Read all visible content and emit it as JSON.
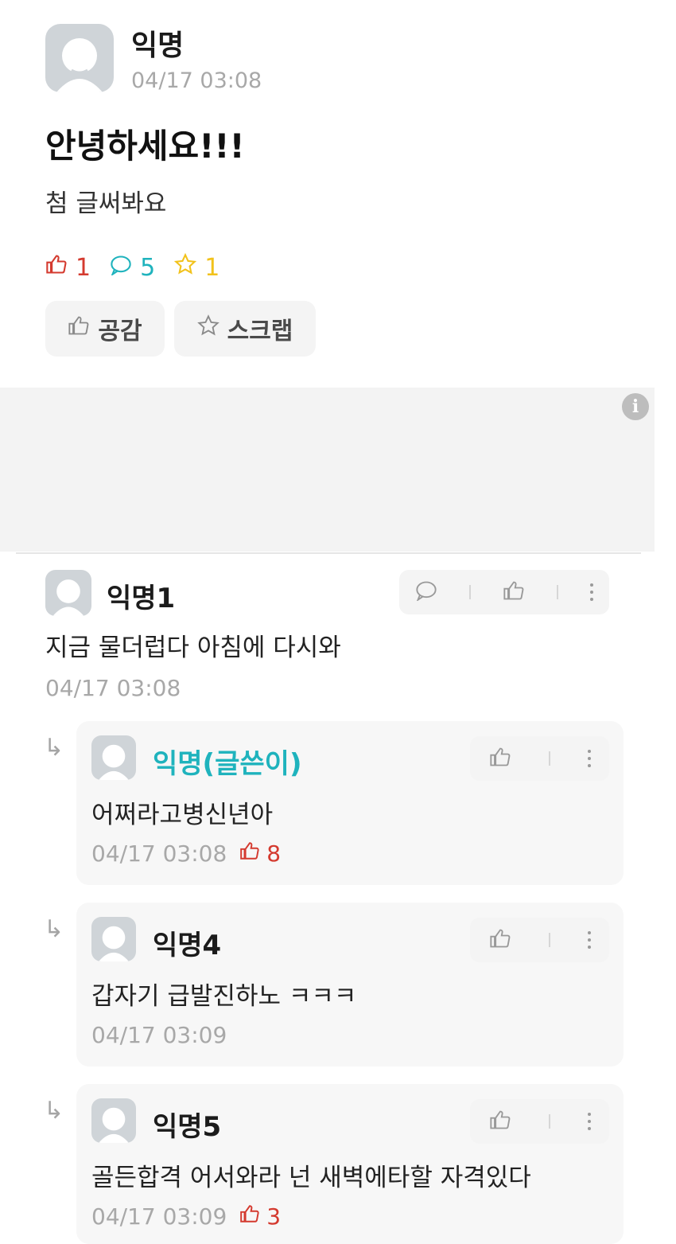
{
  "post": {
    "author": "익명",
    "time": "04/17 03:08",
    "title": "안녕하세요!!!",
    "body": "첨 글써봐요",
    "stats": {
      "likes": "1",
      "comments": "5",
      "scraps": "1"
    },
    "buttons": {
      "like": "공감",
      "scrap": "스크랩"
    }
  },
  "comments": [
    {
      "author": "익명1",
      "text": "지금 물더럽다 아침에 다시와",
      "time": "04/17 03:08"
    }
  ],
  "replies": [
    {
      "author": "익명(글쓴이)",
      "text": "어쩌라고병신년아",
      "time": "04/17 03:08",
      "likes": "8"
    },
    {
      "author": "익명4",
      "text": "갑자기 급발진하노 ㅋㅋㅋ",
      "time": "04/17 03:09"
    },
    {
      "author": "익명5",
      "text": "골든합격 어서와라 넌 새벽에타할 자격있다",
      "time": "04/17 03:09",
      "likes": "3"
    }
  ],
  "colors": {
    "like_red": "#d43a2f",
    "comment_cyan": "#1fb3bd",
    "scrap_yellow": "#f2c21b",
    "op_cyan": "#1fb3bd"
  }
}
